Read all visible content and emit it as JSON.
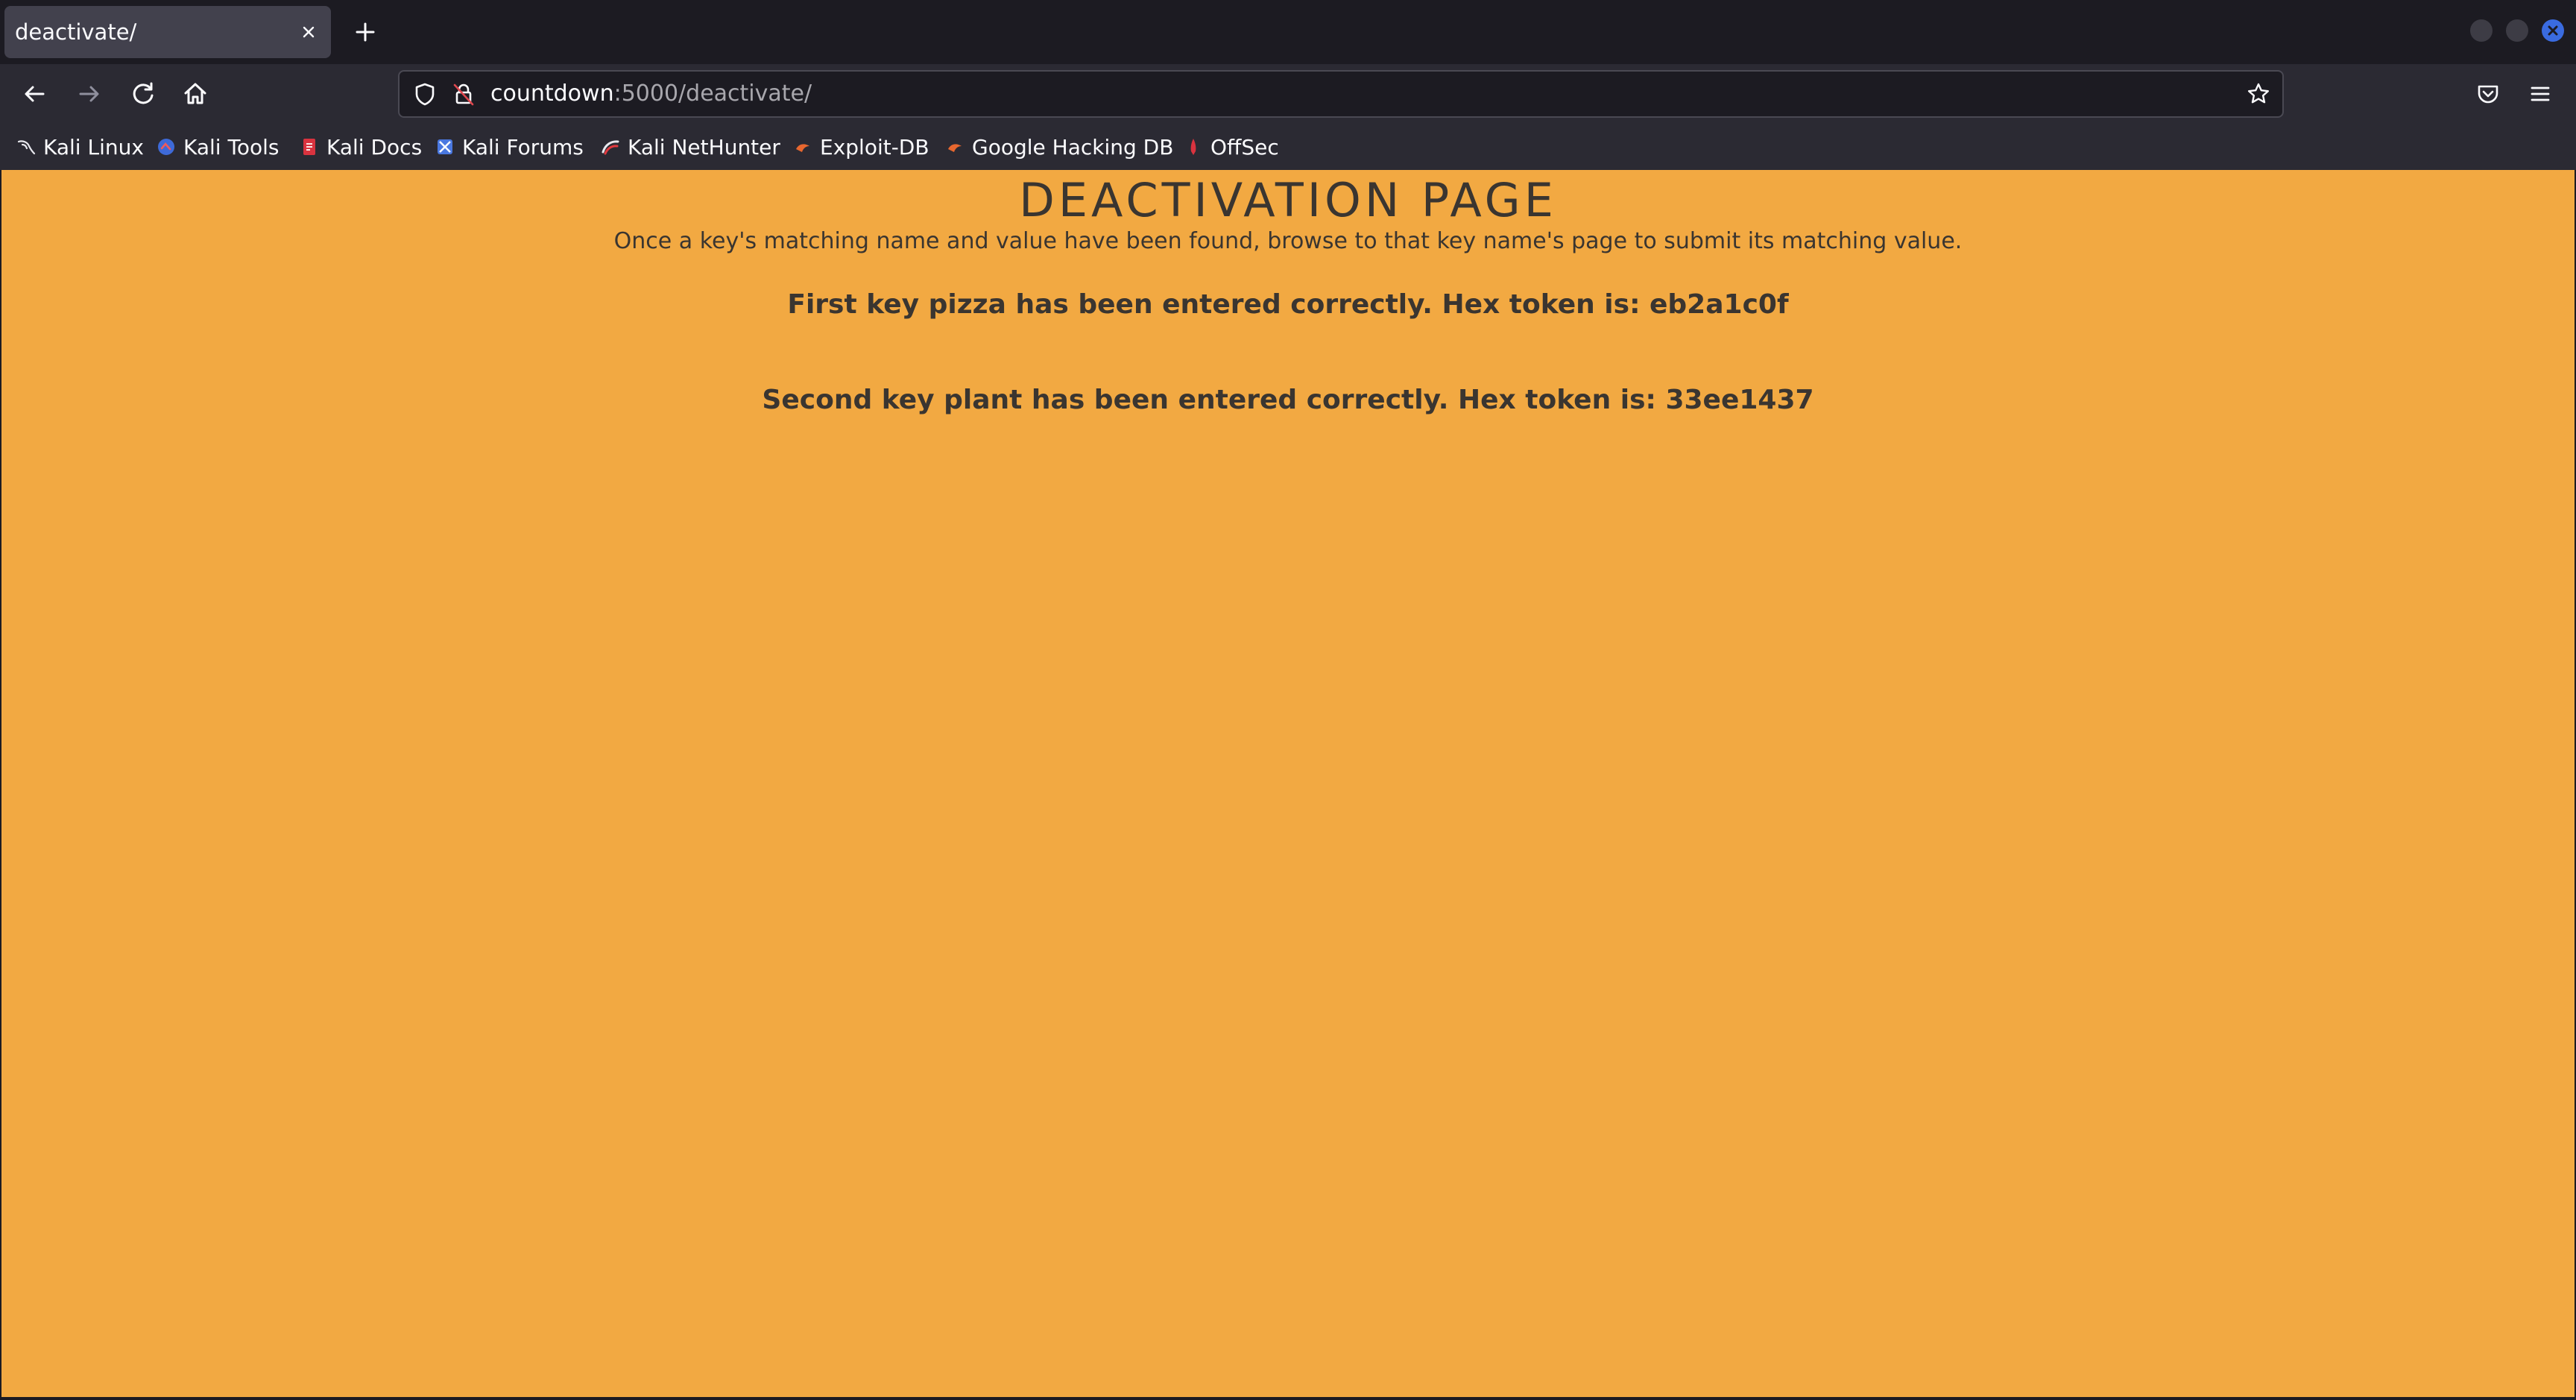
{
  "browser": {
    "tab": {
      "title": "deactivate/",
      "close_icon": "close-icon"
    },
    "new_tab_icon": "plus-icon",
    "window_controls": [
      "minimize",
      "maximize",
      "close"
    ],
    "nav": {
      "back_icon": "arrow-left-icon",
      "forward_icon": "arrow-right-icon",
      "reload_icon": "reload-icon",
      "home_icon": "home-icon"
    },
    "url": {
      "host": "countdown",
      "path": ":5000/deactivate/"
    },
    "bookmarks": [
      {
        "label": "Kali Linux",
        "icon": "kali-dragon-icon"
      },
      {
        "label": "Kali Tools",
        "icon": "kali-tools-icon"
      },
      {
        "label": "Kali Docs",
        "icon": "kali-docs-icon"
      },
      {
        "label": "Kali Forums",
        "icon": "kali-forums-icon"
      },
      {
        "label": "Kali NetHunter",
        "icon": "nethunter-icon"
      },
      {
        "label": "Exploit-DB",
        "icon": "exploit-db-icon"
      },
      {
        "label": "Google Hacking DB",
        "icon": "ghdb-icon"
      },
      {
        "label": "OffSec",
        "icon": "offsec-icon"
      }
    ]
  },
  "page": {
    "title": "DEACTIVATION PAGE",
    "subtitle": "Once a key's matching name and value have been found, browse to that key name's page to submit its matching value.",
    "messages": [
      "First key pizza has been entered correctly. Hex token is: eb2a1c0f",
      "Second key plant has been entered correctly. Hex token is: 33ee1437"
    ],
    "background_color": "#f2a942",
    "text_color": "#3a3530"
  }
}
